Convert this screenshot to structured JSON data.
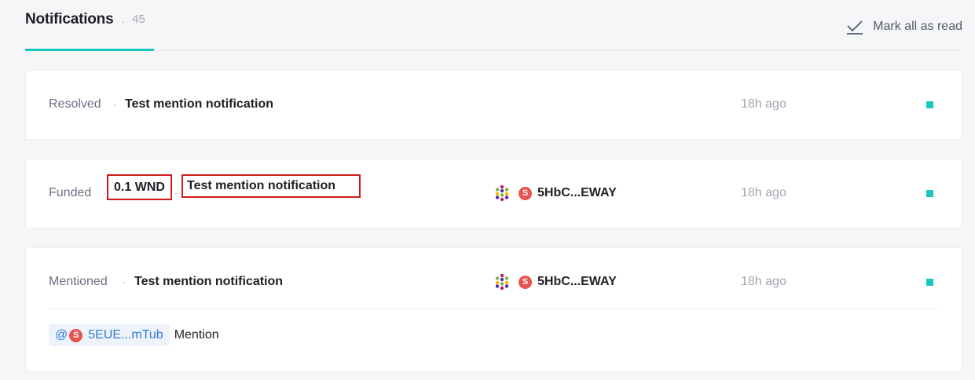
{
  "header": {
    "title": "Notifications",
    "dot": "·",
    "count": "45",
    "mark_all_label": "Mark all as read"
  },
  "colors": {
    "accent": "#18c8c0",
    "highlight_box": "#d11a1a",
    "badge": "#e8534e",
    "mention_link": "#2e7cd2"
  },
  "notifications": [
    {
      "status": "Resolved",
      "sep": "·",
      "title": "Test mention notification",
      "time": "18h ago"
    },
    {
      "status": "Funded",
      "sep": "·",
      "amount": "0.1 WND",
      "title": "Test mention notification",
      "user_badge": "S",
      "address": "5HbC...EWAY",
      "time": "18h ago"
    },
    {
      "status": "Mentioned",
      "sep": "·",
      "title": "Test mention notification",
      "user_badge": "S",
      "address": "5HbC...EWAY",
      "time": "18h ago",
      "mention": {
        "at": "@",
        "badge": "S",
        "address": "5EUE...mTub",
        "text": "Mention"
      }
    }
  ]
}
